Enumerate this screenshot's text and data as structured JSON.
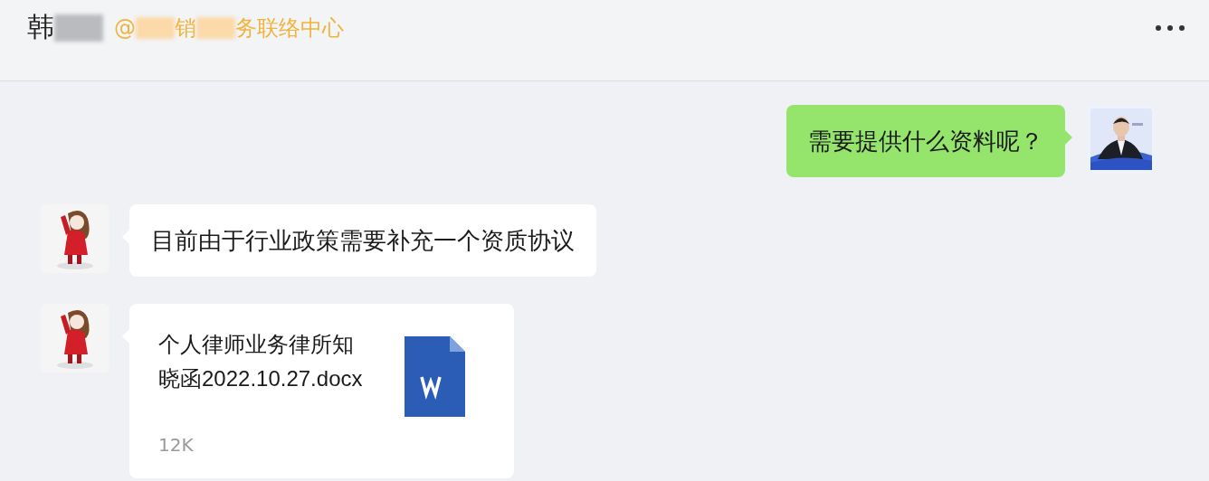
{
  "header": {
    "name": [
      {
        "kind": "text",
        "text": "韩"
      },
      {
        "kind": "redacted"
      }
    ],
    "org": [
      {
        "kind": "text",
        "text": "@"
      },
      {
        "kind": "redacted"
      },
      {
        "kind": "text",
        "text": "销"
      },
      {
        "kind": "redacted"
      },
      {
        "kind": "text",
        "text": "务联络中心"
      }
    ]
  },
  "messages": [
    {
      "outgoing": true,
      "kind": "text",
      "avatar": {
        "kind": "person"
      },
      "text": "需要提供什么资料呢？"
    },
    {
      "outgoing": false,
      "kind": "text",
      "avatar": {
        "kind": "cartoon"
      },
      "text": "目前由于行业政策需要补充一个资质协议"
    },
    {
      "outgoing": false,
      "kind": "file",
      "avatar": {
        "kind": "cartoon"
      },
      "file_name": "个人律师业务律所知晓函2022.10.27.docx",
      "size": "12K"
    }
  ]
}
